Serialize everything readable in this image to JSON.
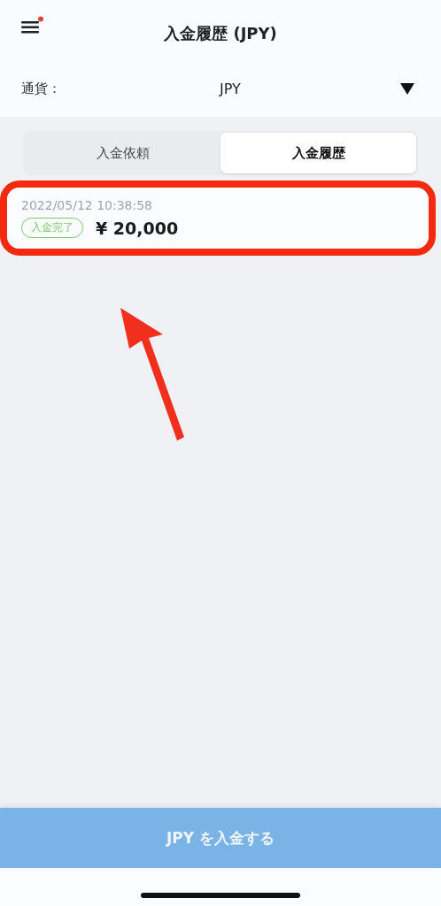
{
  "header": {
    "title": "入金履歴 (JPY)",
    "menu_notification": true
  },
  "currency": {
    "label": "通貨：",
    "value": "JPY"
  },
  "tabs": [
    {
      "label": "入金依頼",
      "selected": false
    },
    {
      "label": "入金履歴",
      "selected": true
    }
  ],
  "history": [
    {
      "datetime": "2022/05/12 10:38:58",
      "status": {
        "label": "入金完了",
        "kind": "completed"
      },
      "amount": "¥ 20,000",
      "highlighted": true
    }
  ],
  "deposit_button": {
    "label": "JPY を入金する",
    "disabled": true
  }
}
